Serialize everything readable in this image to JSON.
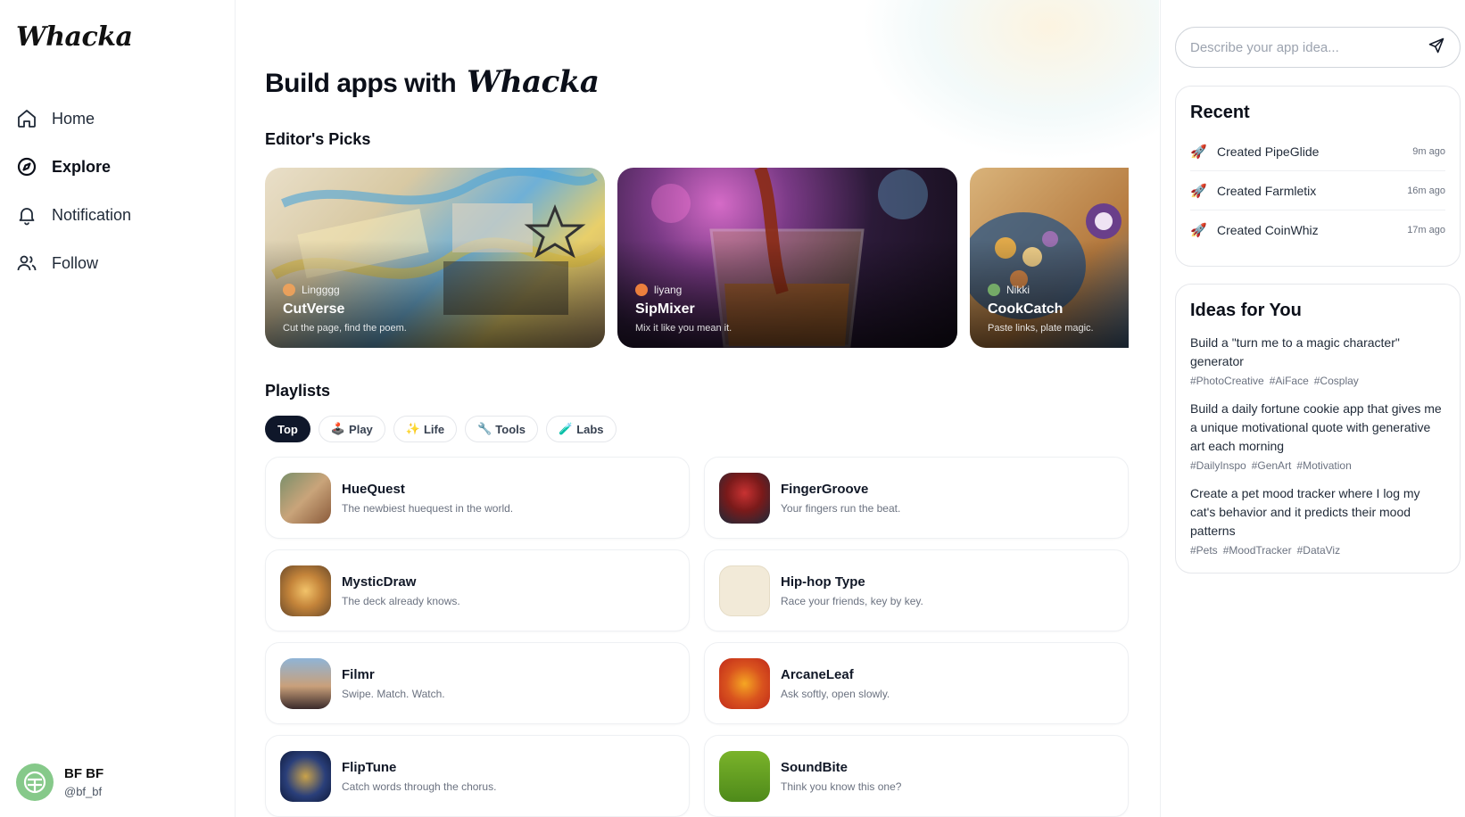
{
  "app": {
    "logo": "Whacka"
  },
  "sidebar": {
    "nav": [
      {
        "label": "Home",
        "icon": "home-icon"
      },
      {
        "label": "Explore",
        "icon": "compass-icon",
        "active": true
      },
      {
        "label": "Notification",
        "icon": "bell-icon"
      },
      {
        "label": "Follow",
        "icon": "users-icon"
      }
    ],
    "user": {
      "name": "BF BF",
      "handle": "@bf_bf"
    }
  },
  "main": {
    "hero_prefix": "Build apps with",
    "hero_brand": "Whacka",
    "editors_picks_title": "Editor's Picks",
    "picks": [
      {
        "author": "Lingggg",
        "title": "CutVerse",
        "desc": "Cut the page, find the poem."
      },
      {
        "author": "liyang",
        "title": "SipMixer",
        "desc": "Mix it like you mean it."
      },
      {
        "author": "Nikki",
        "title": "CookCatch",
        "desc": "Paste links, plate magic."
      }
    ],
    "playlists_title": "Playlists",
    "chips": [
      {
        "label": "Top",
        "icon": ""
      },
      {
        "label": "Play",
        "icon": "🕹️"
      },
      {
        "label": "Life",
        "icon": "✨"
      },
      {
        "label": "Tools",
        "icon": "🔧"
      },
      {
        "label": "Labs",
        "icon": "🧪"
      }
    ],
    "apps": [
      {
        "title": "HueQuest",
        "desc": "The newbiest huequest in the world."
      },
      {
        "title": "FingerGroove",
        "desc": "Your fingers run the beat."
      },
      {
        "title": "MysticDraw",
        "desc": "The deck already knows."
      },
      {
        "title": "Hip-hop Type",
        "desc": "Race your friends, key by key."
      },
      {
        "title": "Filmr",
        "desc": "Swipe. Match. Watch."
      },
      {
        "title": "ArcaneLeaf",
        "desc": "Ask softly, open slowly."
      },
      {
        "title": "FlipTune",
        "desc": "Catch words through the chorus."
      },
      {
        "title": "SoundBite",
        "desc": "Think you know this one?"
      }
    ]
  },
  "right": {
    "search_placeholder": "Describe your app idea...",
    "recent_title": "Recent",
    "recent": [
      {
        "text": "Created PipeGlide",
        "time": "9m ago"
      },
      {
        "text": "Created Farmletix",
        "time": "16m ago"
      },
      {
        "text": "Created CoinWhiz",
        "time": "17m ago"
      }
    ],
    "ideas_title": "Ideas for You",
    "ideas": [
      {
        "text": "Build a \"turn me to a magic character\" generator",
        "tags": [
          "#PhotoCreative",
          "#AiFace",
          "#Cosplay"
        ]
      },
      {
        "text": "Build a daily fortune cookie app that gives me a unique motivational quote with generative art each morning",
        "tags": [
          "#DailyInspo",
          "#GenArt",
          "#Motivation"
        ]
      },
      {
        "text": "Create a pet mood tracker where I log my cat's behavior and it predicts their mood patterns",
        "tags": [
          "#Pets",
          "#MoodTracker",
          "#DataViz"
        ]
      }
    ]
  },
  "colors": {
    "accent_dark": "#0f172a",
    "muted": "#6b7280",
    "avatar_bg": "#86c98a"
  }
}
